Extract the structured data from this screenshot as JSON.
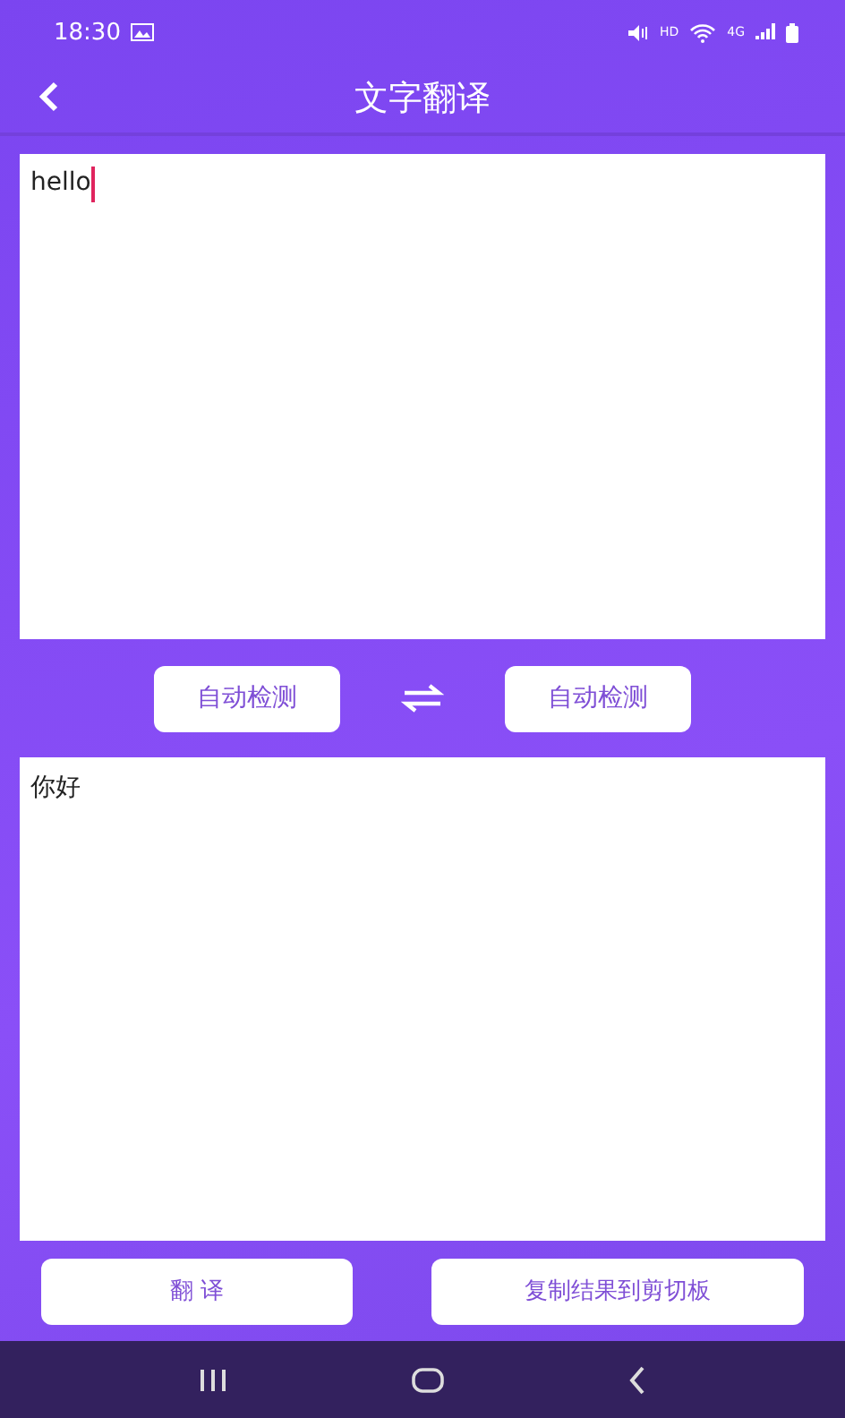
{
  "status_bar": {
    "time": "18:30",
    "hd": "HD",
    "network": "4G"
  },
  "header": {
    "title": "文字翻译"
  },
  "source": {
    "value": "hello"
  },
  "languages": {
    "from": "自动检测",
    "to": "自动检测"
  },
  "result": {
    "text": "你好"
  },
  "buttons": [
    {
      "label": "翻 译"
    },
    {
      "label": "复制结果到剪切板"
    }
  ]
}
